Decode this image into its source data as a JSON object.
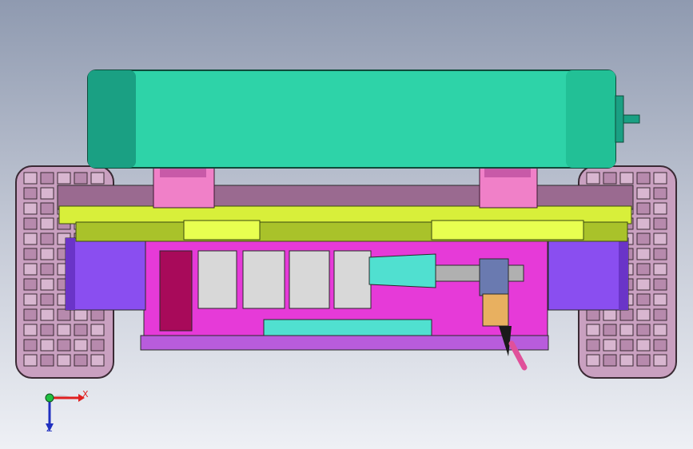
{
  "viewport": {
    "background_top": "#8f9ab0",
    "background_bottom": "#eef0f5"
  },
  "model": {
    "parts": [
      "cylinder-tank",
      "mounting-brackets",
      "top-plate",
      "chassis-frame",
      "left-wheel",
      "right-wheel",
      "left-motor",
      "right-motor",
      "gear-blocks",
      "drive-shaft",
      "spring",
      "gear",
      "lever"
    ],
    "colors": {
      "tank": "#2ed3a8",
      "tank_dark": "#1aa083",
      "bracket": "#f080c8",
      "plate": "#d8ef3a",
      "plate_dark": "#a9c22a",
      "frame": "#9a6a90",
      "wheel": "#c9a0c0",
      "motor": "#8a4ef0",
      "gear_block": "#d8d8d8",
      "magenta": "#e63ad8",
      "purple_frame": "#b85cdc",
      "spring": "#6a7ab0",
      "gear": "#e8b060"
    }
  },
  "triad": {
    "x_label": "X",
    "y_label": "Z",
    "x_color": "#e02020",
    "y_color": "#2030c0",
    "origin_color": "#20c040"
  }
}
